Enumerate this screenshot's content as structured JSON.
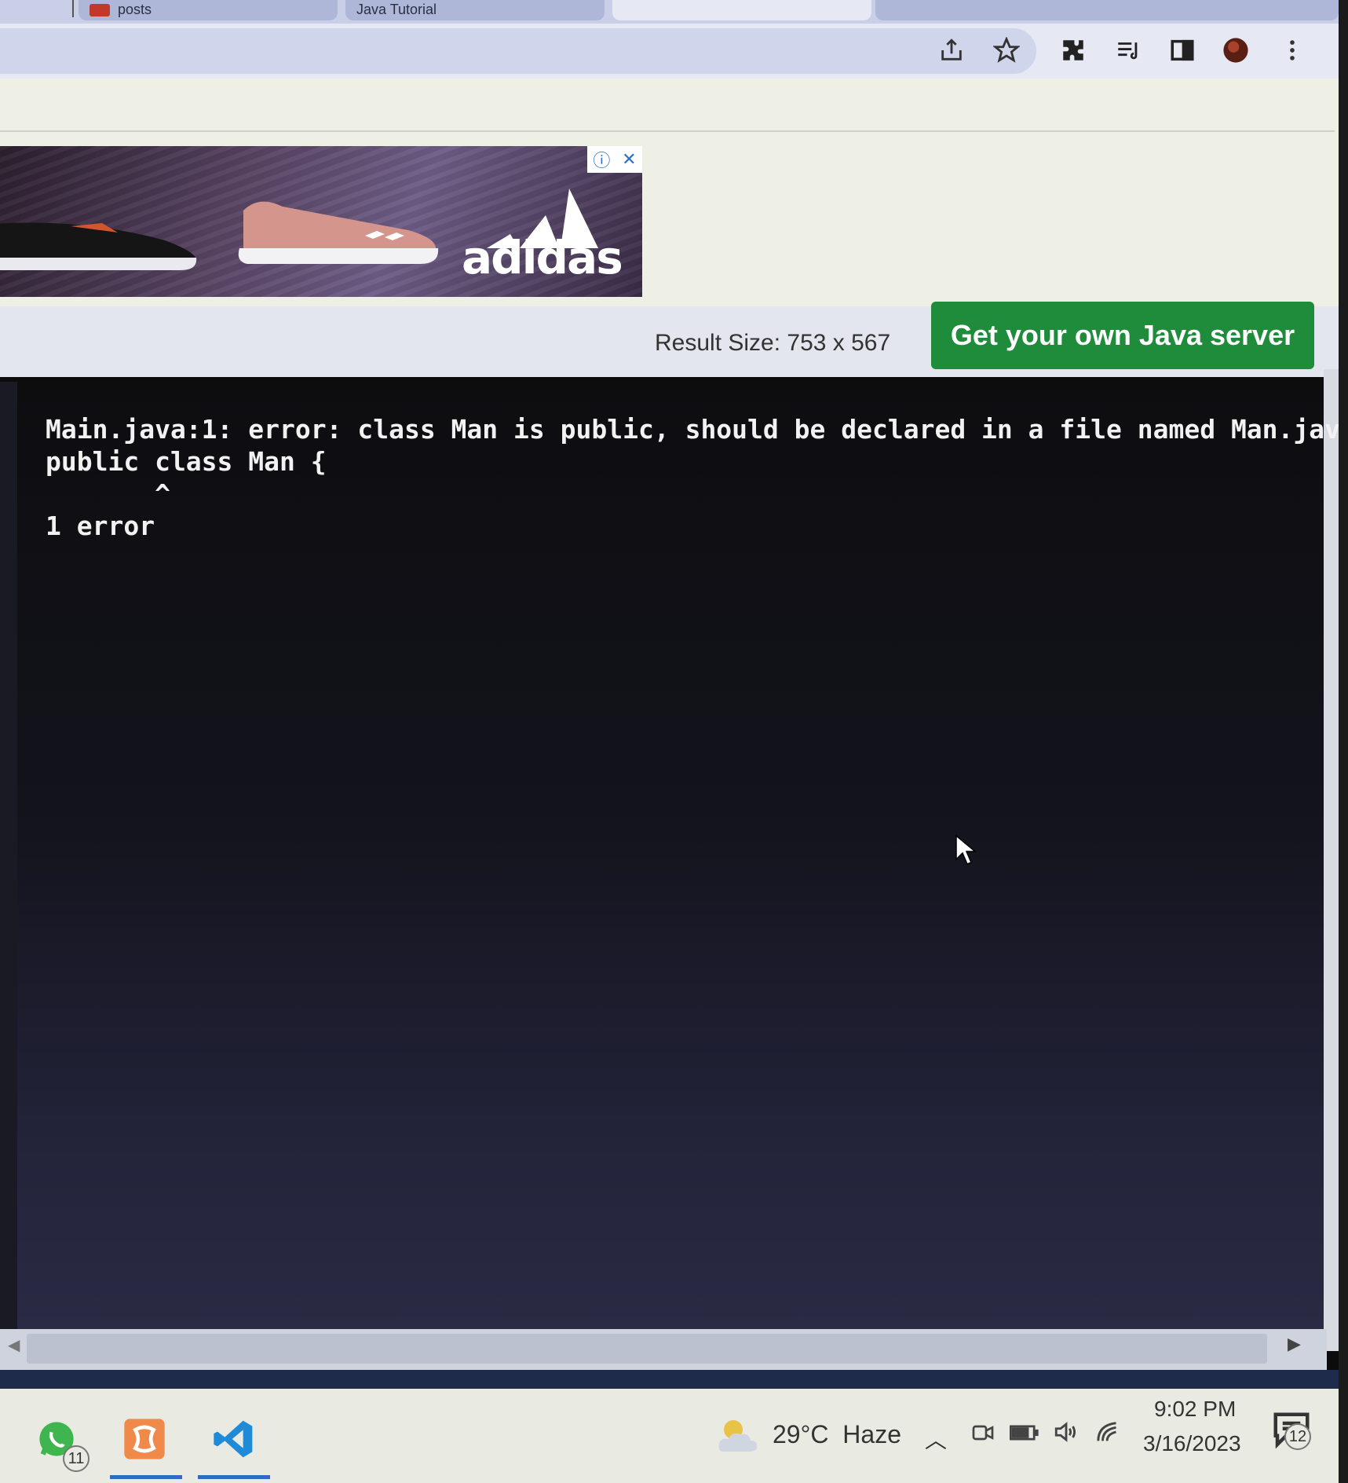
{
  "browser": {
    "tabs": [
      {
        "label": "posts"
      },
      {
        "label": "Java Tutorial"
      }
    ],
    "toolbar_icons": [
      "share-icon",
      "bookmark-star-icon",
      "extensions-icon",
      "reading-list-icon",
      "side-panel-icon",
      "profile-avatar",
      "more-menu-icon"
    ]
  },
  "ad": {
    "brand": "adidas",
    "info_icon": "info-icon",
    "close_icon": "close-icon"
  },
  "result_bar": {
    "size_label": "Result Size: 753 x 567",
    "server_button": "Get your own Java server"
  },
  "console": {
    "output": "Main.java:1: error: class Man is public, should be declared in a file named Man.jav\npublic class Man {\n       ^\n1 error"
  },
  "taskbar": {
    "apps": [
      {
        "name": "whatsapp",
        "badge": "11"
      },
      {
        "name": "xampp"
      },
      {
        "name": "vscode"
      }
    ],
    "weather": {
      "temp": "29°C",
      "condition": "Haze"
    },
    "time": "9:02 PM",
    "date": "3/16/2023",
    "notification_count": "12"
  }
}
